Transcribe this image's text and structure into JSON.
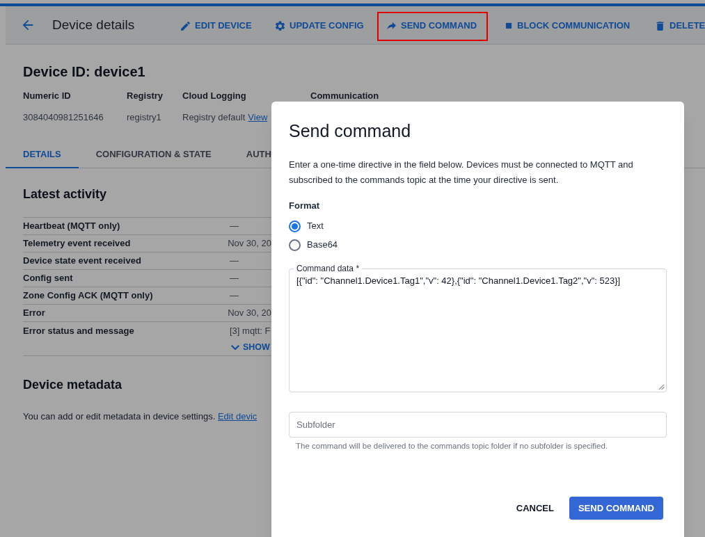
{
  "toolbar": {
    "title": "Device details",
    "actions": [
      {
        "label": "EDIT DEVICE",
        "kind": "edit",
        "highlighted": false
      },
      {
        "label": "UPDATE CONFIG",
        "kind": "config",
        "highlighted": false
      },
      {
        "label": "SEND COMMAND",
        "kind": "send",
        "highlighted": true
      },
      {
        "label": "BLOCK COMMUNICATION",
        "kind": "block",
        "highlighted": false
      },
      {
        "label": "DELETE",
        "kind": "delete",
        "highlighted": false
      }
    ]
  },
  "device": {
    "heading": "Device ID: device1",
    "fields": [
      {
        "label": "Numeric ID",
        "value": "3084040981251646"
      },
      {
        "label": "Registry",
        "value": "registry1"
      },
      {
        "label": "Cloud Logging",
        "value": "Registry default",
        "link": "View"
      },
      {
        "label": "Communication"
      }
    ]
  },
  "tabs": [
    {
      "label": "DETAILS",
      "selected": true
    },
    {
      "label": "CONFIGURATION & STATE",
      "selected": false
    },
    {
      "label": "AUTH",
      "selected": false
    }
  ],
  "latest_activity": {
    "title": "Latest activity",
    "rows": [
      {
        "label": "Heartbeat (MQTT only)",
        "value": "—"
      },
      {
        "label": "Telemetry event received",
        "value": "Nov 30, 20"
      },
      {
        "label": "Device state event received",
        "value": "—"
      },
      {
        "label": "Config sent",
        "value": "—"
      },
      {
        "label": "Zone Config ACK (MQTT only)",
        "value": "—"
      },
      {
        "label": "Error",
        "value": "Nov 30, 20"
      },
      {
        "label": "Error status and message",
        "value": "[3] mqtt: F"
      }
    ],
    "show_more": "SHOW"
  },
  "metadata": {
    "title": "Device metadata",
    "text": "You can add or edit metadata in device settings.",
    "link": "Edit devic"
  },
  "dialog": {
    "title": "Send command",
    "description": "Enter a one-time directive in the field below. Devices must be connected to MQTT and subscribed to the commands topic at the time your directive is sent.",
    "format_label": "Format",
    "formats": [
      {
        "label": "Text",
        "selected": true
      },
      {
        "label": "Base64",
        "selected": false
      }
    ],
    "command_data": {
      "label": "Command data *",
      "value": "[{\"id\": \"Channel1.Device1.Tag1\",\"v\": 42},{\"id\": \"Channel1.Device1.Tag2\",\"v\": 523}]"
    },
    "subfolder": {
      "placeholder": "Subfolder",
      "hint": "The command will be delivered to the commands topic folder if no subfolder is specified."
    },
    "buttons": [
      {
        "label": "CANCEL",
        "kind": "text"
      },
      {
        "label": "SEND COMMAND",
        "kind": "primary"
      }
    ]
  }
}
